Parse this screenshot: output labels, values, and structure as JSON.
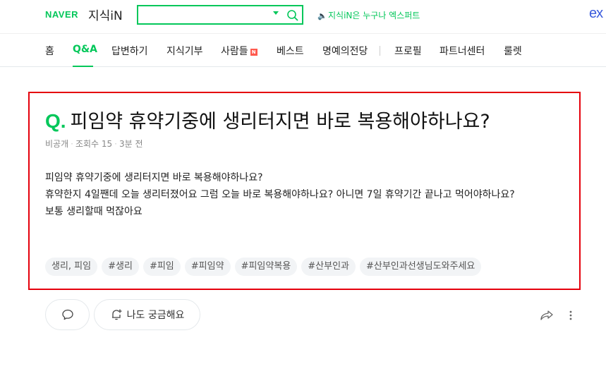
{
  "header": {
    "brand": "NAVER",
    "service": "지식iN",
    "search": {
      "value": "",
      "placeholder": ""
    },
    "promo": "지식iN은 누구나 엑스퍼트",
    "ex_logo": "ex",
    "accent_color": "#03c75a"
  },
  "nav": {
    "items": [
      {
        "label": "홈"
      },
      {
        "label": "Q&A",
        "active": true
      },
      {
        "label": "답변하기"
      },
      {
        "label": "지식기부"
      },
      {
        "label": "사람들",
        "badge": "N"
      },
      {
        "label": "베스트"
      },
      {
        "label": "명예의전당"
      },
      {
        "label": "프로필"
      },
      {
        "label": "파트너센터"
      },
      {
        "label": "룰렛"
      }
    ]
  },
  "question": {
    "mark": "Q.",
    "title": "피임약 휴약기중에 생리터지면 바로 복용해야하나요?",
    "author": "비공개",
    "views": "조회수 15",
    "time": "3분 전",
    "body": [
      "피임약 휴약기중에 생리터지면 바로 복용해야하나요?",
      "휴약한지 4일짼데 오늘 생리터졌어요 그럼 오늘 바로 복용해야하나요? 아니면 7일 휴약기간 끝나고 먹어야하나요?",
      "보통 생리할때 먹잖아요"
    ],
    "tags": [
      "생리, 피임",
      "#생리",
      "#피임",
      "#피임약",
      "#피임약복용",
      "#산부인과",
      "#산부인과선생님도와주세요"
    ],
    "highlight_color": "#e5000c"
  },
  "actions": {
    "curious_label": "나도 궁금해요"
  }
}
